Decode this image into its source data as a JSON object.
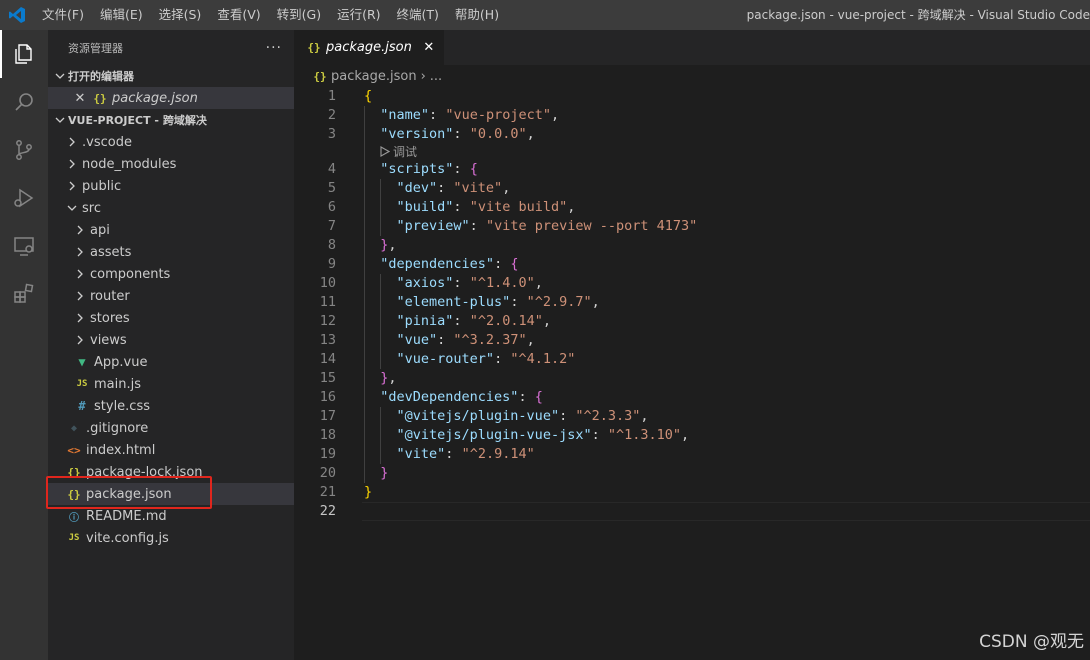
{
  "menu": [
    "文件(F)",
    "编辑(E)",
    "选择(S)",
    "查看(V)",
    "转到(G)",
    "运行(R)",
    "终端(T)",
    "帮助(H)"
  ],
  "window_title": "package.json - vue-project - 跨域解决 - Visual Studio Code",
  "activity_icons": [
    "explorer-icon",
    "search-icon",
    "source-control-icon",
    "run-debug-icon",
    "remote-explorer-icon",
    "extensions-icon"
  ],
  "sidebar": {
    "title": "资源管理器",
    "more": "···",
    "open_editors_label": "打开的编辑器",
    "open_editors": [
      {
        "name": "package.json",
        "icon": "json-icon"
      }
    ],
    "project_label": "VUE-PROJECT - 跨域解决",
    "tree": [
      {
        "name": ".vscode",
        "type": "folder",
        "depth": 1
      },
      {
        "name": "node_modules",
        "type": "folder",
        "depth": 1
      },
      {
        "name": "public",
        "type": "folder",
        "depth": 1
      },
      {
        "name": "src",
        "type": "folder-open",
        "depth": 1
      },
      {
        "name": "api",
        "type": "folder",
        "depth": 2
      },
      {
        "name": "assets",
        "type": "folder",
        "depth": 2
      },
      {
        "name": "components",
        "type": "folder",
        "depth": 2
      },
      {
        "name": "router",
        "type": "folder",
        "depth": 2
      },
      {
        "name": "stores",
        "type": "folder",
        "depth": 2
      },
      {
        "name": "views",
        "type": "folder",
        "depth": 2
      },
      {
        "name": "App.vue",
        "type": "vue",
        "depth": 2
      },
      {
        "name": "main.js",
        "type": "js",
        "depth": 2
      },
      {
        "name": "style.css",
        "type": "css",
        "depth": 2
      },
      {
        "name": ".gitignore",
        "type": "git",
        "depth": 1
      },
      {
        "name": "index.html",
        "type": "html",
        "depth": 1
      },
      {
        "name": "package-lock.json",
        "type": "json",
        "depth": 1
      },
      {
        "name": "package.json",
        "type": "json",
        "depth": 1,
        "selected": true
      },
      {
        "name": "README.md",
        "type": "info",
        "depth": 1
      },
      {
        "name": "vite.config.js",
        "type": "js",
        "depth": 1
      }
    ]
  },
  "editor": {
    "tab_label": "package.json",
    "breadcrumb_file": "package.json",
    "breadcrumb_more": "...",
    "codelens": "调试",
    "current_line": 22,
    "lines": [
      {
        "n": "1",
        "t": [
          [
            "b1",
            "{"
          ]
        ]
      },
      {
        "n": "2",
        "t": [
          [
            "p",
            "  "
          ],
          [
            "k",
            "\"name\""
          ],
          [
            "p",
            ": "
          ],
          [
            "s",
            "\"vue-project\""
          ],
          [
            "p",
            ","
          ]
        ]
      },
      {
        "n": "3",
        "t": [
          [
            "p",
            "  "
          ],
          [
            "k",
            "\"version\""
          ],
          [
            "p",
            ": "
          ],
          [
            "s",
            "\"0.0.0\""
          ],
          [
            "p",
            ","
          ]
        ]
      },
      {
        "n": "4",
        "t": [
          [
            "p",
            "  "
          ],
          [
            "k",
            "\"scripts\""
          ],
          [
            "p",
            ": "
          ],
          [
            "b2",
            "{"
          ]
        ]
      },
      {
        "n": "5",
        "t": [
          [
            "p",
            "    "
          ],
          [
            "k",
            "\"dev\""
          ],
          [
            "p",
            ": "
          ],
          [
            "s",
            "\"vite\""
          ],
          [
            "p",
            ","
          ]
        ]
      },
      {
        "n": "6",
        "t": [
          [
            "p",
            "    "
          ],
          [
            "k",
            "\"build\""
          ],
          [
            "p",
            ": "
          ],
          [
            "s",
            "\"vite build\""
          ],
          [
            "p",
            ","
          ]
        ]
      },
      {
        "n": "7",
        "t": [
          [
            "p",
            "    "
          ],
          [
            "k",
            "\"preview\""
          ],
          [
            "p",
            ": "
          ],
          [
            "s",
            "\"vite preview --port 4173\""
          ]
        ]
      },
      {
        "n": "8",
        "t": [
          [
            "p",
            "  "
          ],
          [
            "b2",
            "}"
          ],
          [
            "p",
            ","
          ]
        ]
      },
      {
        "n": "9",
        "t": [
          [
            "p",
            "  "
          ],
          [
            "k",
            "\"dependencies\""
          ],
          [
            "p",
            ": "
          ],
          [
            "b2",
            "{"
          ]
        ]
      },
      {
        "n": "10",
        "t": [
          [
            "p",
            "    "
          ],
          [
            "k",
            "\"axios\""
          ],
          [
            "p",
            ": "
          ],
          [
            "s",
            "\"^1.4.0\""
          ],
          [
            "p",
            ","
          ]
        ]
      },
      {
        "n": "11",
        "t": [
          [
            "p",
            "    "
          ],
          [
            "k",
            "\"element-plus\""
          ],
          [
            "p",
            ": "
          ],
          [
            "s",
            "\"^2.9.7\""
          ],
          [
            "p",
            ","
          ]
        ]
      },
      {
        "n": "12",
        "t": [
          [
            "p",
            "    "
          ],
          [
            "k",
            "\"pinia\""
          ],
          [
            "p",
            ": "
          ],
          [
            "s",
            "\"^2.0.14\""
          ],
          [
            "p",
            ","
          ]
        ]
      },
      {
        "n": "13",
        "t": [
          [
            "p",
            "    "
          ],
          [
            "k",
            "\"vue\""
          ],
          [
            "p",
            ": "
          ],
          [
            "s",
            "\"^3.2.37\""
          ],
          [
            "p",
            ","
          ]
        ]
      },
      {
        "n": "14",
        "t": [
          [
            "p",
            "    "
          ],
          [
            "k",
            "\"vue-router\""
          ],
          [
            "p",
            ": "
          ],
          [
            "s",
            "\"^4.1.2\""
          ]
        ]
      },
      {
        "n": "15",
        "t": [
          [
            "p",
            "  "
          ],
          [
            "b2",
            "}"
          ],
          [
            "p",
            ","
          ]
        ]
      },
      {
        "n": "16",
        "t": [
          [
            "p",
            "  "
          ],
          [
            "k",
            "\"devDependencies\""
          ],
          [
            "p",
            ": "
          ],
          [
            "b2",
            "{"
          ]
        ]
      },
      {
        "n": "17",
        "t": [
          [
            "p",
            "    "
          ],
          [
            "k",
            "\"@vitejs/plugin-vue\""
          ],
          [
            "p",
            ": "
          ],
          [
            "s",
            "\"^2.3.3\""
          ],
          [
            "p",
            ","
          ]
        ]
      },
      {
        "n": "18",
        "t": [
          [
            "p",
            "    "
          ],
          [
            "k",
            "\"@vitejs/plugin-vue-jsx\""
          ],
          [
            "p",
            ": "
          ],
          [
            "s",
            "\"^1.3.10\""
          ],
          [
            "p",
            ","
          ]
        ]
      },
      {
        "n": "19",
        "t": [
          [
            "p",
            "    "
          ],
          [
            "k",
            "\"vite\""
          ],
          [
            "p",
            ": "
          ],
          [
            "s",
            "\"^2.9.14\""
          ]
        ]
      },
      {
        "n": "20",
        "t": [
          [
            "p",
            "  "
          ],
          [
            "b2",
            "}"
          ]
        ]
      },
      {
        "n": "21",
        "t": [
          [
            "b1",
            "}"
          ]
        ]
      },
      {
        "n": "22",
        "t": []
      }
    ]
  },
  "watermark": "CSDN @观无",
  "colors": {
    "key": "#9cdcfe",
    "string": "#ce9178",
    "bracket1": "#ffd700",
    "bracket2": "#da70d6",
    "highlight": "#e0261d"
  }
}
